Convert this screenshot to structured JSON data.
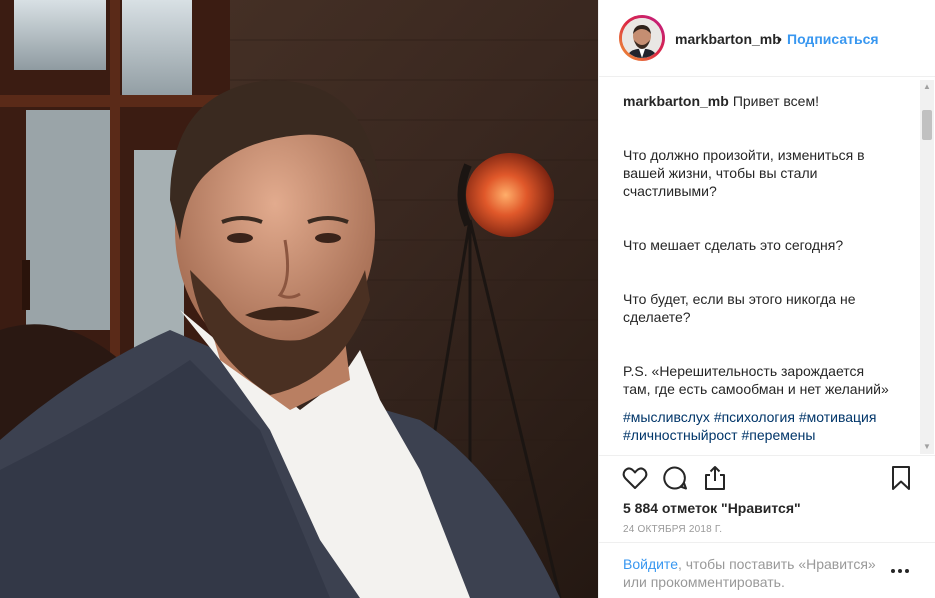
{
  "post": {
    "username": "markbarton_mb",
    "follow_label": "Подписаться",
    "separator": "•"
  },
  "caption": {
    "username": "markbarton_mb",
    "greeting": "Привет всем!",
    "para1": "Что должно произойти, измениться в вашей жизни, чтобы вы стали счастливыми?",
    "para2": "Что мешает сделать это сегодня?",
    "para3": "Что будет, если вы этого никогда не сделаете?",
    "para4": "P.S. «Нерешительность зарождается там, где есть самообман и нет желаний»",
    "hashtags": [
      "#мысливслух",
      "#психология",
      "#мотивация",
      "#личностныйрост",
      "#перемены"
    ]
  },
  "actions": {
    "like_icon": "heart-icon",
    "comment_icon": "comment-icon",
    "share_icon": "share-icon",
    "save_icon": "bookmark-icon"
  },
  "likes_text": "5 884 отметок \"Нравится\"",
  "date_text": "24 ОКТЯБРЯ 2018 Г.",
  "footer": {
    "login_link": "Войдите",
    "rest": ", чтобы поставить «Нравится» или прокомментировать.",
    "more_icon": "more-options-icon"
  },
  "colors": {
    "link": "#3897f0",
    "hashtag": "#003569",
    "muted": "#999999"
  }
}
